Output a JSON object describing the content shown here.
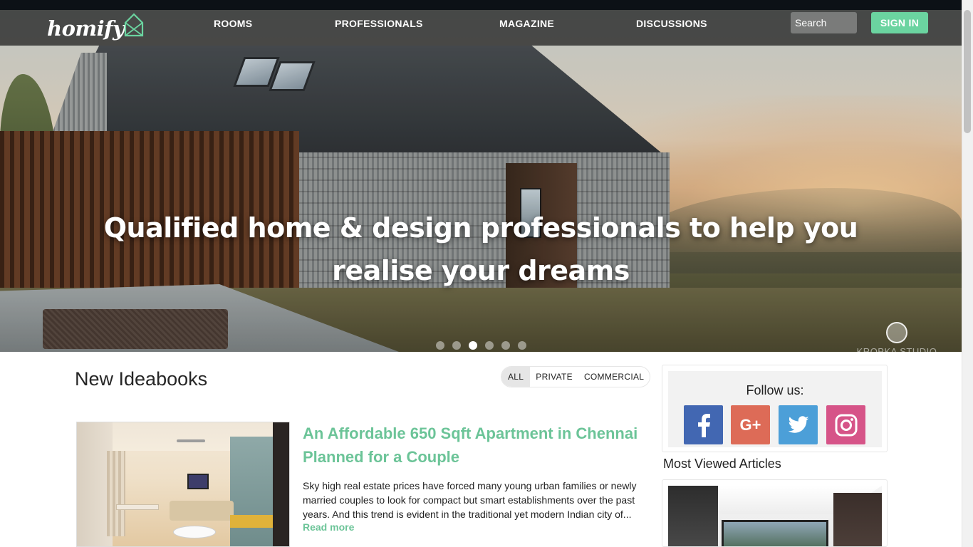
{
  "nav": {
    "logo_text": "homify",
    "links": [
      "ROOMS",
      "PROFESSIONALS",
      "MAGAZINE",
      "DISCUSSIONS"
    ],
    "search_placeholder": "Search",
    "signin_label": "SIGN IN"
  },
  "hero": {
    "headline_line1": "Qualified home & design professionals to help you",
    "headline_line2": "realise your dreams",
    "slide_count": 6,
    "active_slide": 3,
    "credit": "KROPKA STUDIO"
  },
  "ideabooks": {
    "title": "New Ideabooks",
    "filters": [
      "ALL",
      "PRIVATE",
      "COMMERCIAL"
    ],
    "active_filter": "ALL",
    "article": {
      "title": "An Affordable 650 Sqft Apartment in Chennai Planned for a Couple",
      "description": "Sky high real estate prices have forced many young urban families or newly married couples to look for compact but smart establishments over the past years.  And this trend is evident in the traditional yet modern Indian city of...",
      "read_more": "Read more"
    }
  },
  "sidebar": {
    "follow_title": "Follow us:",
    "socials": [
      {
        "name": "facebook",
        "icon": "facebook-icon",
        "color": "#4267b2"
      },
      {
        "name": "google-plus",
        "icon": "google-plus-icon",
        "color": "#dd6b57",
        "label": "G+"
      },
      {
        "name": "twitter",
        "icon": "twitter-icon",
        "color": "#4c9fd8"
      },
      {
        "name": "instagram",
        "icon": "instagram-icon",
        "color": "#d65488"
      }
    ],
    "most_viewed_title": "Most Viewed Articles"
  },
  "colors": {
    "accent_green": "#6cc498",
    "signin_green": "#6bd4a0"
  }
}
